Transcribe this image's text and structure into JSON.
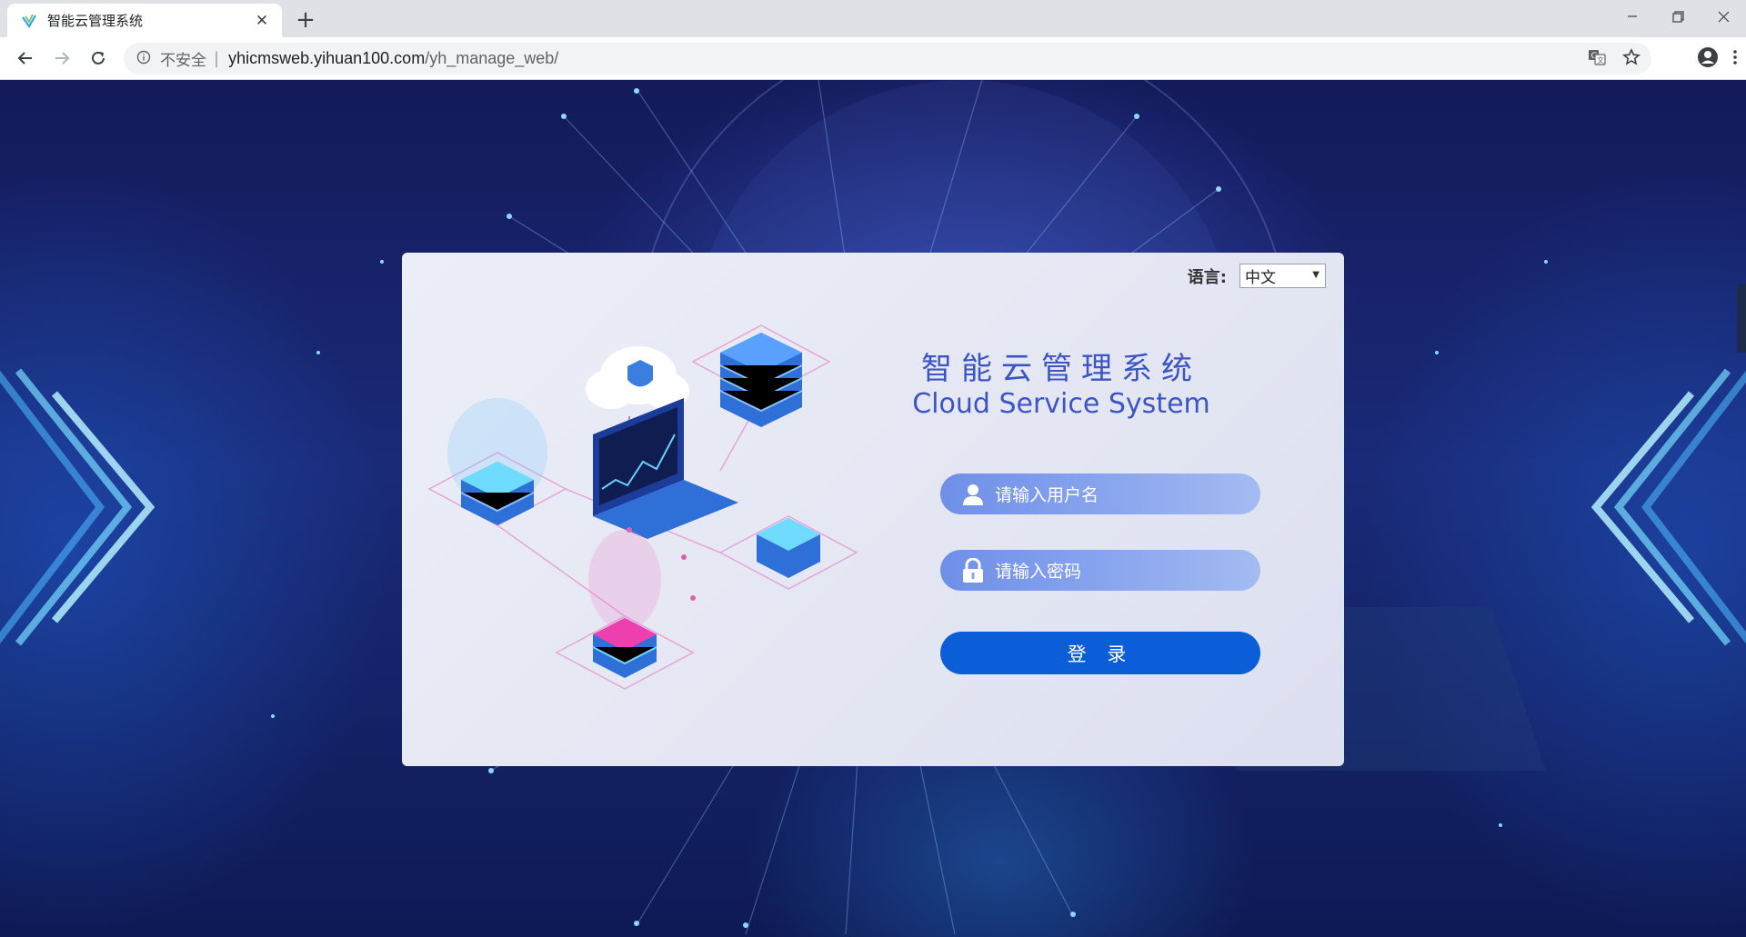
{
  "browser": {
    "tab_title": "智能云管理系统",
    "security_label": "不安全",
    "url_host": "yhicmsweb.yihuan100.com",
    "url_path": "/yh_manage_web/"
  },
  "login": {
    "language_label": "语言:",
    "language_selected": "中文",
    "title_cn": "智能云管理系统",
    "title_en": "Cloud Service System",
    "username_placeholder": "请输入用户名",
    "password_placeholder": "请输入密码",
    "login_button": "登 录"
  },
  "colors": {
    "accent": "#0c5ed8",
    "title": "#3b56c4",
    "field_gradient_start": "#6f8fe8",
    "field_gradient_end": "#a4bbf2"
  },
  "icons": [
    "shield-favicon-icon",
    "close-icon",
    "plus-icon",
    "minimize-icon",
    "restore-icon",
    "back-arrow-icon",
    "forward-arrow-icon",
    "reload-icon",
    "info-icon",
    "translate-icon",
    "star-icon",
    "account-icon",
    "more-vert-icon",
    "user-icon",
    "lock-icon"
  ]
}
